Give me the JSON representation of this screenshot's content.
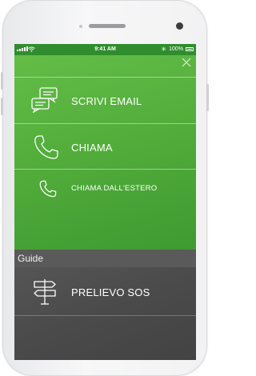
{
  "statusbar": {
    "time": "9:41 AM",
    "battery": "100%",
    "bluetooth_icon": "bluetooth-icon"
  },
  "menu": {
    "close_icon": "close-icon",
    "items": [
      {
        "label": "SCRIVI EMAIL",
        "icon": "chat-bubbles-icon"
      },
      {
        "label": "CHIAMA",
        "icon": "phone-icon"
      },
      {
        "label": "CHIAMA DALL'ESTERO",
        "icon": "phone-icon"
      }
    ]
  },
  "guide": {
    "header": "Guide",
    "items": [
      {
        "label": "PRELIEVO SOS",
        "icon": "signpost-icon"
      }
    ]
  },
  "colors": {
    "accent_green": "#4faa39",
    "status_green": "#2f8d2e",
    "dark_gray": "#4b4b4b"
  }
}
